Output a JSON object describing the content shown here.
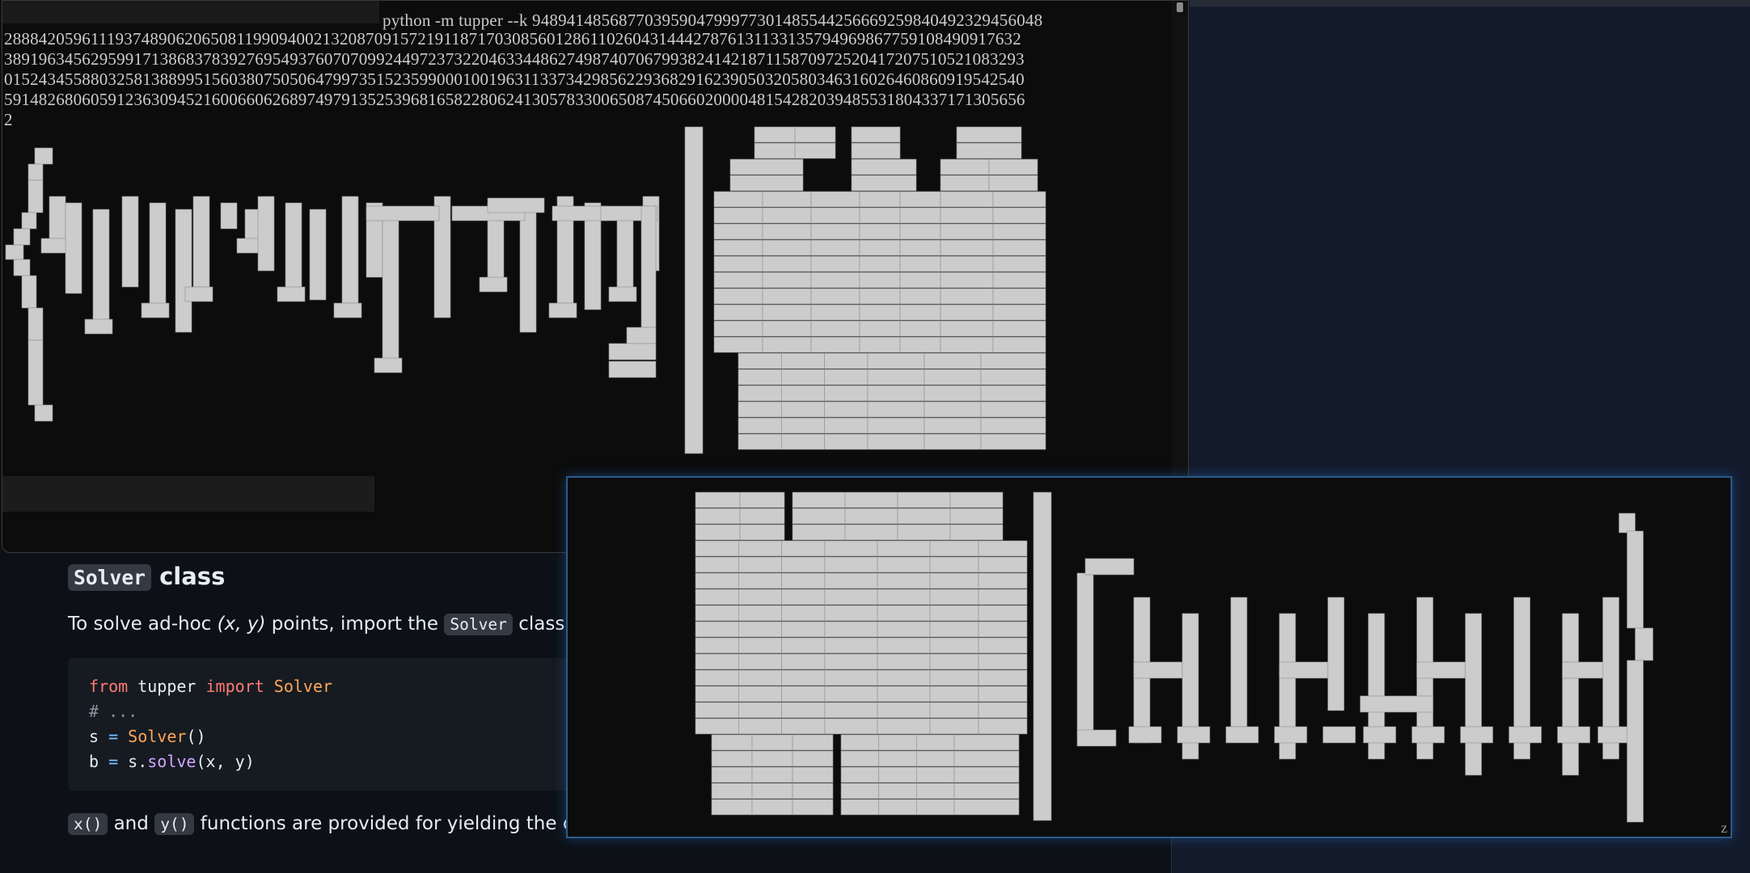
{
  "terminal_top": {
    "command": "python -m tupper --k 94894148568770395904799977301485544256669259840492329456048",
    "k_lines": [
      "2888420596111937489062065081199094002132087091572191187170308560128611026043144427876131133135794969867759108490917632",
      "3891963456295991713868378392769549376070709924497237322046334486274987407067993824142187115870972520417207510521083293",
      "0152434558803258138899515603807505064799735152359900010019631133734298562293682916239050320580346316026460860919542540",
      "5914826806059123630945216006606268974979135253968165822806241305783300650874506602000048154282039485531804337171305656",
      "2"
    ],
    "tupper_output_text": "{pyWT}_:-aqvm]|{69}",
    "scrollbar_label": "terminal scrollbar"
  },
  "terminal_bottom": {
    "tupper_output_text": "{69}|{ute_right}",
    "corner_char": "z"
  },
  "readme": {
    "section_code": "Solver",
    "section_word": " class",
    "intro_before": "To solve ad-hoc ",
    "intro_em": "(x, y)",
    "intro_mid": " points, import the ",
    "intro_code": "Solver",
    "intro_after": " class a",
    "code_lines": {
      "l1_from": "from",
      "l1_mod": " tupper ",
      "l1_import": "import",
      "l1_cls": " Solver",
      "l2_comment": "# ...",
      "l3_var": "s ",
      "l3_eq": "=",
      "l3_cls": " Solver",
      "l3_rest": "()",
      "l4_var": "b ",
      "l4_eq": "=",
      "l4_obj": " s.",
      "l4_fn": "solve",
      "l4_rest": "(x, y)"
    },
    "p2_code1": "x()",
    "p2_and": " and ",
    "p2_code2": "y()",
    "p2_rest": " functions are provided for yielding the coordinates of a graph:"
  },
  "colors": {
    "terminal_bg": "#0c0c0c",
    "pixel_fill": "#cccccc",
    "page_bg": "#0d1117",
    "window_border_active": "#2b5c8e"
  }
}
